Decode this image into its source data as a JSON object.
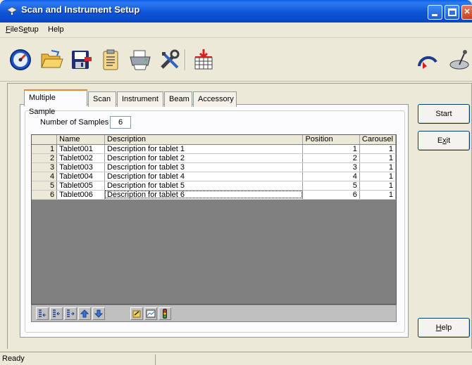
{
  "window": {
    "title": "Scan and Instrument Setup"
  },
  "menu": {
    "file": {
      "hotkey": "F",
      "rest": "ile"
    },
    "setup": {
      "before": "S",
      "hotkey": "e",
      "rest": "tup"
    },
    "help": "Help"
  },
  "toolbar": {
    "buttons": [
      "gauge-icon",
      "folder-open-icon",
      "save-disk-icon",
      "clipboard-icon",
      "printer-icon",
      "tools-icon",
      "grid-insert-icon"
    ],
    "right_buttons": [
      "arc-arrow-icon",
      "satellite-dish-icon"
    ]
  },
  "tabs": [
    "Multiple Sample",
    "Scan",
    "Instrument",
    "Beam",
    "Accessory"
  ],
  "samples": {
    "label": "Number of Samples",
    "count": "6"
  },
  "grid": {
    "columns": [
      "Name",
      "Description",
      "Position",
      "Carousel"
    ],
    "rows": [
      {
        "n": "1",
        "name": "Tablet001",
        "desc": "Description for tablet 1",
        "pos": "1",
        "car": "1"
      },
      {
        "n": "2",
        "name": "Tablet002",
        "desc": "Description for tablet 2",
        "pos": "2",
        "car": "1"
      },
      {
        "n": "3",
        "name": "Tablet003",
        "desc": "Description for tablet 3",
        "pos": "3",
        "car": "1"
      },
      {
        "n": "4",
        "name": "Tablet004",
        "desc": "Description for tablet 4",
        "pos": "4",
        "car": "1"
      },
      {
        "n": "5",
        "name": "Tablet005",
        "desc": "Description for tablet 5",
        "pos": "5",
        "car": "1"
      },
      {
        "n": "6",
        "name": "Tablet006",
        "desc": "Description for tablet 6",
        "pos": "6",
        "car": "1"
      }
    ]
  },
  "grid_toolbar": [
    "insert-row-icon",
    "delete-row-icon",
    "append-row-icon",
    "move-up-icon",
    "move-down-icon",
    "edit-note-icon",
    "chart-icon",
    "traffic-light-icon"
  ],
  "actions": {
    "start": "Start",
    "exit": {
      "before": "E",
      "hotkey": "x",
      "rest": "it"
    },
    "help": {
      "hotkey": "H",
      "rest": "elp"
    }
  },
  "status": {
    "text": "Ready"
  }
}
